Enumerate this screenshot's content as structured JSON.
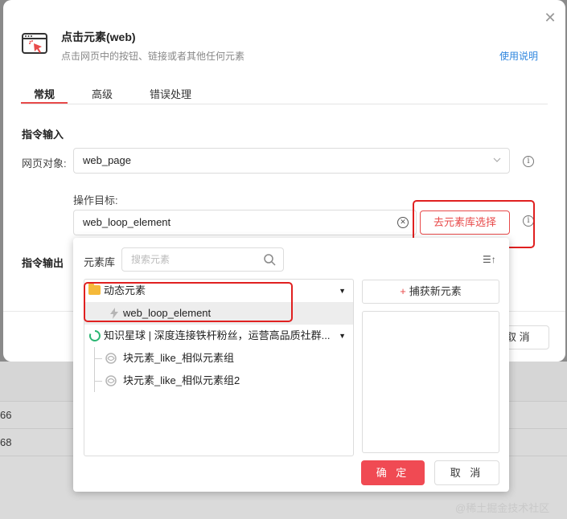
{
  "dialog": {
    "title": "点击元素(web)",
    "subtitle": "点击网页中的按钮、链接或者其他任何元素",
    "help_link": "使用说明",
    "close_glyph": "✕",
    "tabs": [
      {
        "label": "常规",
        "active": true
      },
      {
        "label": "高级",
        "active": false
      },
      {
        "label": "错误处理",
        "active": false
      }
    ],
    "input_section_title": "指令输入",
    "output_section_title": "指令输出",
    "webpage_label": "网页对象:",
    "webpage_value": "web_page",
    "target_label": "操作目标:",
    "target_value": "web_loop_element",
    "library_button": "去元素库选择",
    "background_cancel": "取 消"
  },
  "popup": {
    "library_label": "元素库",
    "search_placeholder": "搜索元素",
    "sort_glyph": "☰↑",
    "tree": [
      {
        "label": "动态元素",
        "type": "folder",
        "expandable": true
      },
      {
        "label": "web_loop_element",
        "type": "element",
        "selected": true
      },
      {
        "label": "知识星球 | 深度连接铁杆粉丝，运营高品质社群...",
        "type": "page",
        "expandable": true
      },
      {
        "label": "块元素_like_相似元素组",
        "type": "element-group"
      },
      {
        "label": "块元素_like_相似元素组2",
        "type": "element-group"
      }
    ],
    "capture_button": "捕获新元素",
    "capture_plus": "+",
    "ok_button": "确 定",
    "cancel_button": "取 消"
  },
  "background": {
    "row_values": [
      "66",
      "68"
    ]
  },
  "watermark": "@稀土掘金技术社区",
  "colors": {
    "accent": "#e84a4a",
    "link": "#2e86de",
    "primary_button": "#f04a53",
    "highlight_box": "#e02020"
  }
}
